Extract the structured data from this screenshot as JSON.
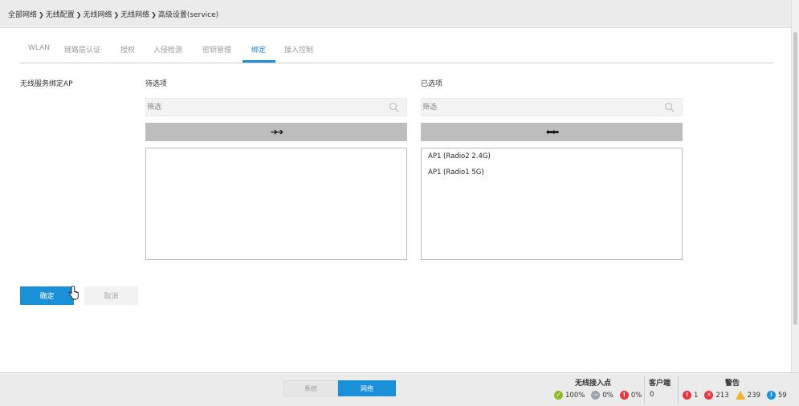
{
  "breadcrumb": [
    "全部网络",
    "无线配置",
    "无线网络",
    "无线网络",
    "高级设置(service)"
  ],
  "tabs": [
    {
      "label": "WLAN",
      "active": false
    },
    {
      "label": "链路层认证",
      "active": false
    },
    {
      "label": "授权",
      "active": false
    },
    {
      "label": "入侵检测",
      "active": false
    },
    {
      "label": "密钥管理",
      "active": false
    },
    {
      "label": "绑定",
      "active": true
    },
    {
      "label": "接入控制",
      "active": false
    }
  ],
  "form": {
    "field_label": "无线服务绑定AP",
    "available": {
      "title": "待选项",
      "filter_placeholder": "筛选",
      "move_label": "➔➔",
      "items": []
    },
    "selected": {
      "title": "已选项",
      "filter_placeholder": "筛选",
      "move_label": "⬅⬅",
      "items": [
        "AP1 (Radio2 2.4G)",
        "AP1 (Radio1 5G)"
      ]
    },
    "ok_label": "确定",
    "cancel_label": "取消"
  },
  "footer": {
    "segments": {
      "system": "系统",
      "network": "网络",
      "active": "network"
    },
    "ap": {
      "title": "无线接入点",
      "online": "100%",
      "offline": "0%",
      "fault": "0%"
    },
    "clients": {
      "title": "客户端",
      "count": "0"
    },
    "alarms": {
      "title": "警告",
      "critical": "1",
      "major": "213",
      "warning": "239",
      "info": "59"
    }
  },
  "colors": {
    "accent": "#1a90d8",
    "ok": "#8bbd2a",
    "gray": "#9aa4ad",
    "red": "#e8373e",
    "warn": "#f0b323",
    "info": "#1a90d8"
  }
}
